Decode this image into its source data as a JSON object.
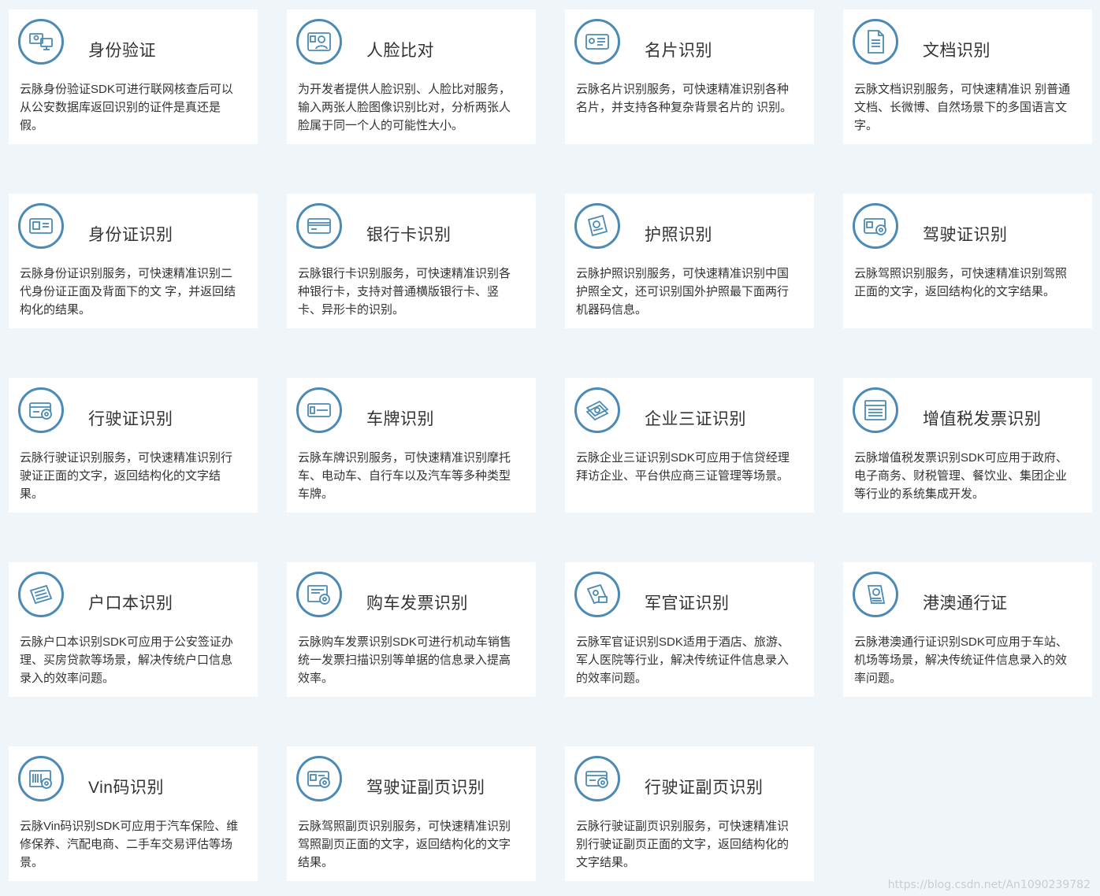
{
  "cards": [
    {
      "icon": "id-verify-icon",
      "title": "身份验证",
      "desc": "云脉身份验证SDK可进行联网核查后可以从公安数据库返回识别的证件是真还是假。"
    },
    {
      "icon": "face-compare-icon",
      "title": "人脸比对",
      "desc": "为开发者提供人脸识别、人脸比对服务，输入两张人脸图像识别比对，分析两张人脸属于同一个人的可能性大小。"
    },
    {
      "icon": "business-card-icon",
      "title": "名片识别",
      "desc": "云脉名片识别服务，可快速精准识别各种名片，并支持各种复杂背景名片的 识别。"
    },
    {
      "icon": "document-icon",
      "title": "文档识别",
      "desc": "云脉文档识别服务，可快速精准识 别普通文档、长微博、自然场景下的多国语言文字。"
    },
    {
      "icon": "id-card-icon",
      "title": "身份证识别",
      "desc": "云脉身份证识别服务，可快速精准识别二代身份证正面及背面下的文 字，并返回结构化的结果。"
    },
    {
      "icon": "bank-card-icon",
      "title": "银行卡识别",
      "desc": "云脉银行卡识别服务，可快速精准识别各种银行卡，支持对普通横版银行卡、竖卡、异形卡的识别。"
    },
    {
      "icon": "passport-icon",
      "title": "护照识别",
      "desc": "云脉护照识别服务，可快速精准识别中国护照全文，还可识别国外护照最下面两行机器码信息。"
    },
    {
      "icon": "driver-license-icon",
      "title": "驾驶证识别",
      "desc": "云脉驾照识别服务，可快速精准识别驾照正面的文字，返回结构化的文字结果。"
    },
    {
      "icon": "vehicle-license-icon",
      "title": "行驶证识别",
      "desc": "云脉行驶证识别服务，可快速精准识别行驶证正面的文字，返回结构化的文字结果。"
    },
    {
      "icon": "license-plate-icon",
      "title": "车牌识别",
      "desc": "云脉车牌识别服务，可快速精准识别摩托车、电动车、自行车以及汽车等多种类型车牌。"
    },
    {
      "icon": "enterprise-cert-icon",
      "title": "企业三证识别",
      "desc": "云脉企业三证识别SDK可应用于信贷经理拜访企业、平台供应商三证管理等场景。"
    },
    {
      "icon": "vat-invoice-icon",
      "title": "增值税发票识别",
      "desc": "云脉增值税发票识别SDK可应用于政府、电子商务、财税管理、餐饮业、集团企业等行业的系统集成开发。"
    },
    {
      "icon": "household-register-icon",
      "title": "户口本识别",
      "desc": "云脉户口本识别SDK可应用于公安签证办理、买房贷款等场景，解决传统户口信息录入的效率问题。"
    },
    {
      "icon": "car-invoice-icon",
      "title": "购车发票识别",
      "desc": "云脉购车发票识别SDK可进行机动车销售统一发票扫描识别等单据的信息录入提高效率。"
    },
    {
      "icon": "military-id-icon",
      "title": "军官证识别",
      "desc": "云脉军官证识别SDK适用于酒店、旅游、军人医院等行业，解决传统证件信息录入的效率问题。"
    },
    {
      "icon": "hk-macau-pass-icon",
      "title": "港澳通行证",
      "desc": "云脉港澳通行证识别SDK可应用于车站、机场等场景，解决传统证件信息录入的效率问题。"
    },
    {
      "icon": "vin-code-icon",
      "title": "Vin码识别",
      "desc": "云脉Vin码识别SDK可应用于汽车保险、维修保养、汽配电商、二手车交易评估等场景。"
    },
    {
      "icon": "driver-license-sub-icon",
      "title": "驾驶证副页识别",
      "desc": "云脉驾照副页识别服务，可快速精准识别驾照副页正面的文字，返回结构化的文字结果。"
    },
    {
      "icon": "vehicle-license-sub-icon",
      "title": "行驶证副页识别",
      "desc": "云脉行驶证副页识别服务，可快速精准识别行驶证副页正面的文字，返回结构化的文字结果。"
    }
  ],
  "watermark": "https://blog.csdn.net/An1090239782",
  "colors": {
    "accent": "#4a8ab5",
    "background": "#f0f5f9",
    "card": "#ffffff",
    "text": "#333333"
  }
}
